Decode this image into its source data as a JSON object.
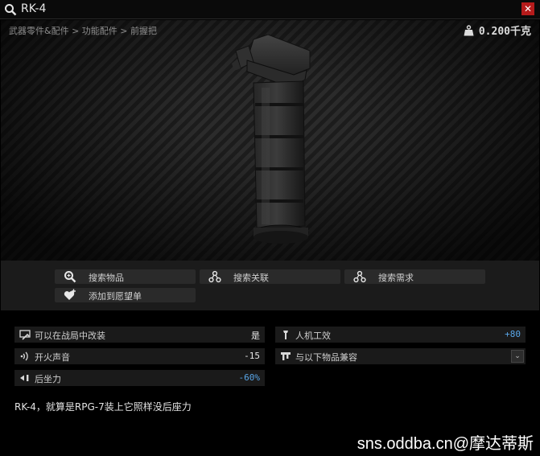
{
  "window": {
    "title": "RK-4",
    "search_icon": "search-icon",
    "close_icon": "close-icon",
    "close_label": "✕"
  },
  "item": {
    "breadcrumb": "武器零件&配件 > 功能配件 > 前握把",
    "weight": "0.200千克",
    "weight_icon": "weight-icon"
  },
  "actions": {
    "search_items": "搜索物品",
    "search_related": "搜索关联",
    "search_required": "搜索需求",
    "add_to_wishlist": "添加到愿望单"
  },
  "stats": {
    "modifiable_in_raid": {
      "label": "可以在战局中改装",
      "value": "是"
    },
    "fire_sound": {
      "label": "开火声音",
      "value": "-15"
    },
    "recoil": {
      "label": "后坐力",
      "value": "-60%"
    },
    "ergonomics": {
      "label": "人机工效",
      "value": "+80"
    },
    "compatible_with": {
      "label": "与以下物品兼容",
      "dropdown": "⌄"
    }
  },
  "description": "RK-4，就算是RPG-7装上它照样没后座力",
  "watermark": "sns.oddba.cn@摩达蒂斯",
  "colors": {
    "positive": "#59a6e8",
    "close": "#b51b1b",
    "panel": "#1b1b1b"
  }
}
